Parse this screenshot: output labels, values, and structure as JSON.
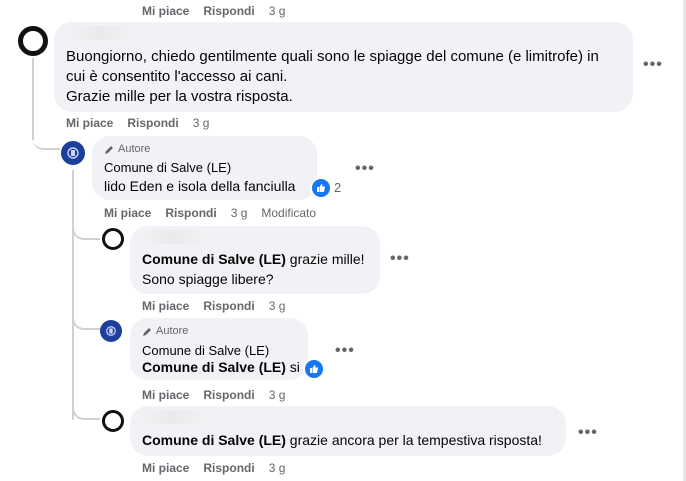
{
  "labels": {
    "like": "Mi piace",
    "reply": "Rispondi",
    "author_badge": "Autore",
    "edited": "Modificato",
    "more_icon": "more-dots-icon"
  },
  "top_actions": {
    "time": "3 g"
  },
  "comment1": {
    "line1": "Buongiorno, chiedo gentilmente quali sono le spiagge del comune (e limitrofe) in",
    "line2": "cui è consentito l'accesso ai cani.",
    "line3": "Grazie mille per la vostra risposta.",
    "time": "3 g"
  },
  "reply1": {
    "author": "Comune di Salve (LE)",
    "text": "lido Eden e isola della fanciulla",
    "reactions": "2",
    "time": "3 g"
  },
  "reply2": {
    "mention": "Comune di Salve (LE)",
    "text1": " grazie mille!",
    "text2": "Sono spiagge libere?",
    "time": "3 g"
  },
  "reply3": {
    "author": "Comune di Salve (LE)",
    "mention": "Comune di Salve (LE)",
    "text": " si",
    "time": "3 g"
  },
  "reply4": {
    "mention": "Comune di Salve (LE)",
    "text": " grazie ancora per la tempestiva risposta!",
    "time": "3 g"
  },
  "colors": {
    "like_blue": "#1877f2",
    "bubble": "#f0f2f5",
    "meta": "#65676b"
  }
}
